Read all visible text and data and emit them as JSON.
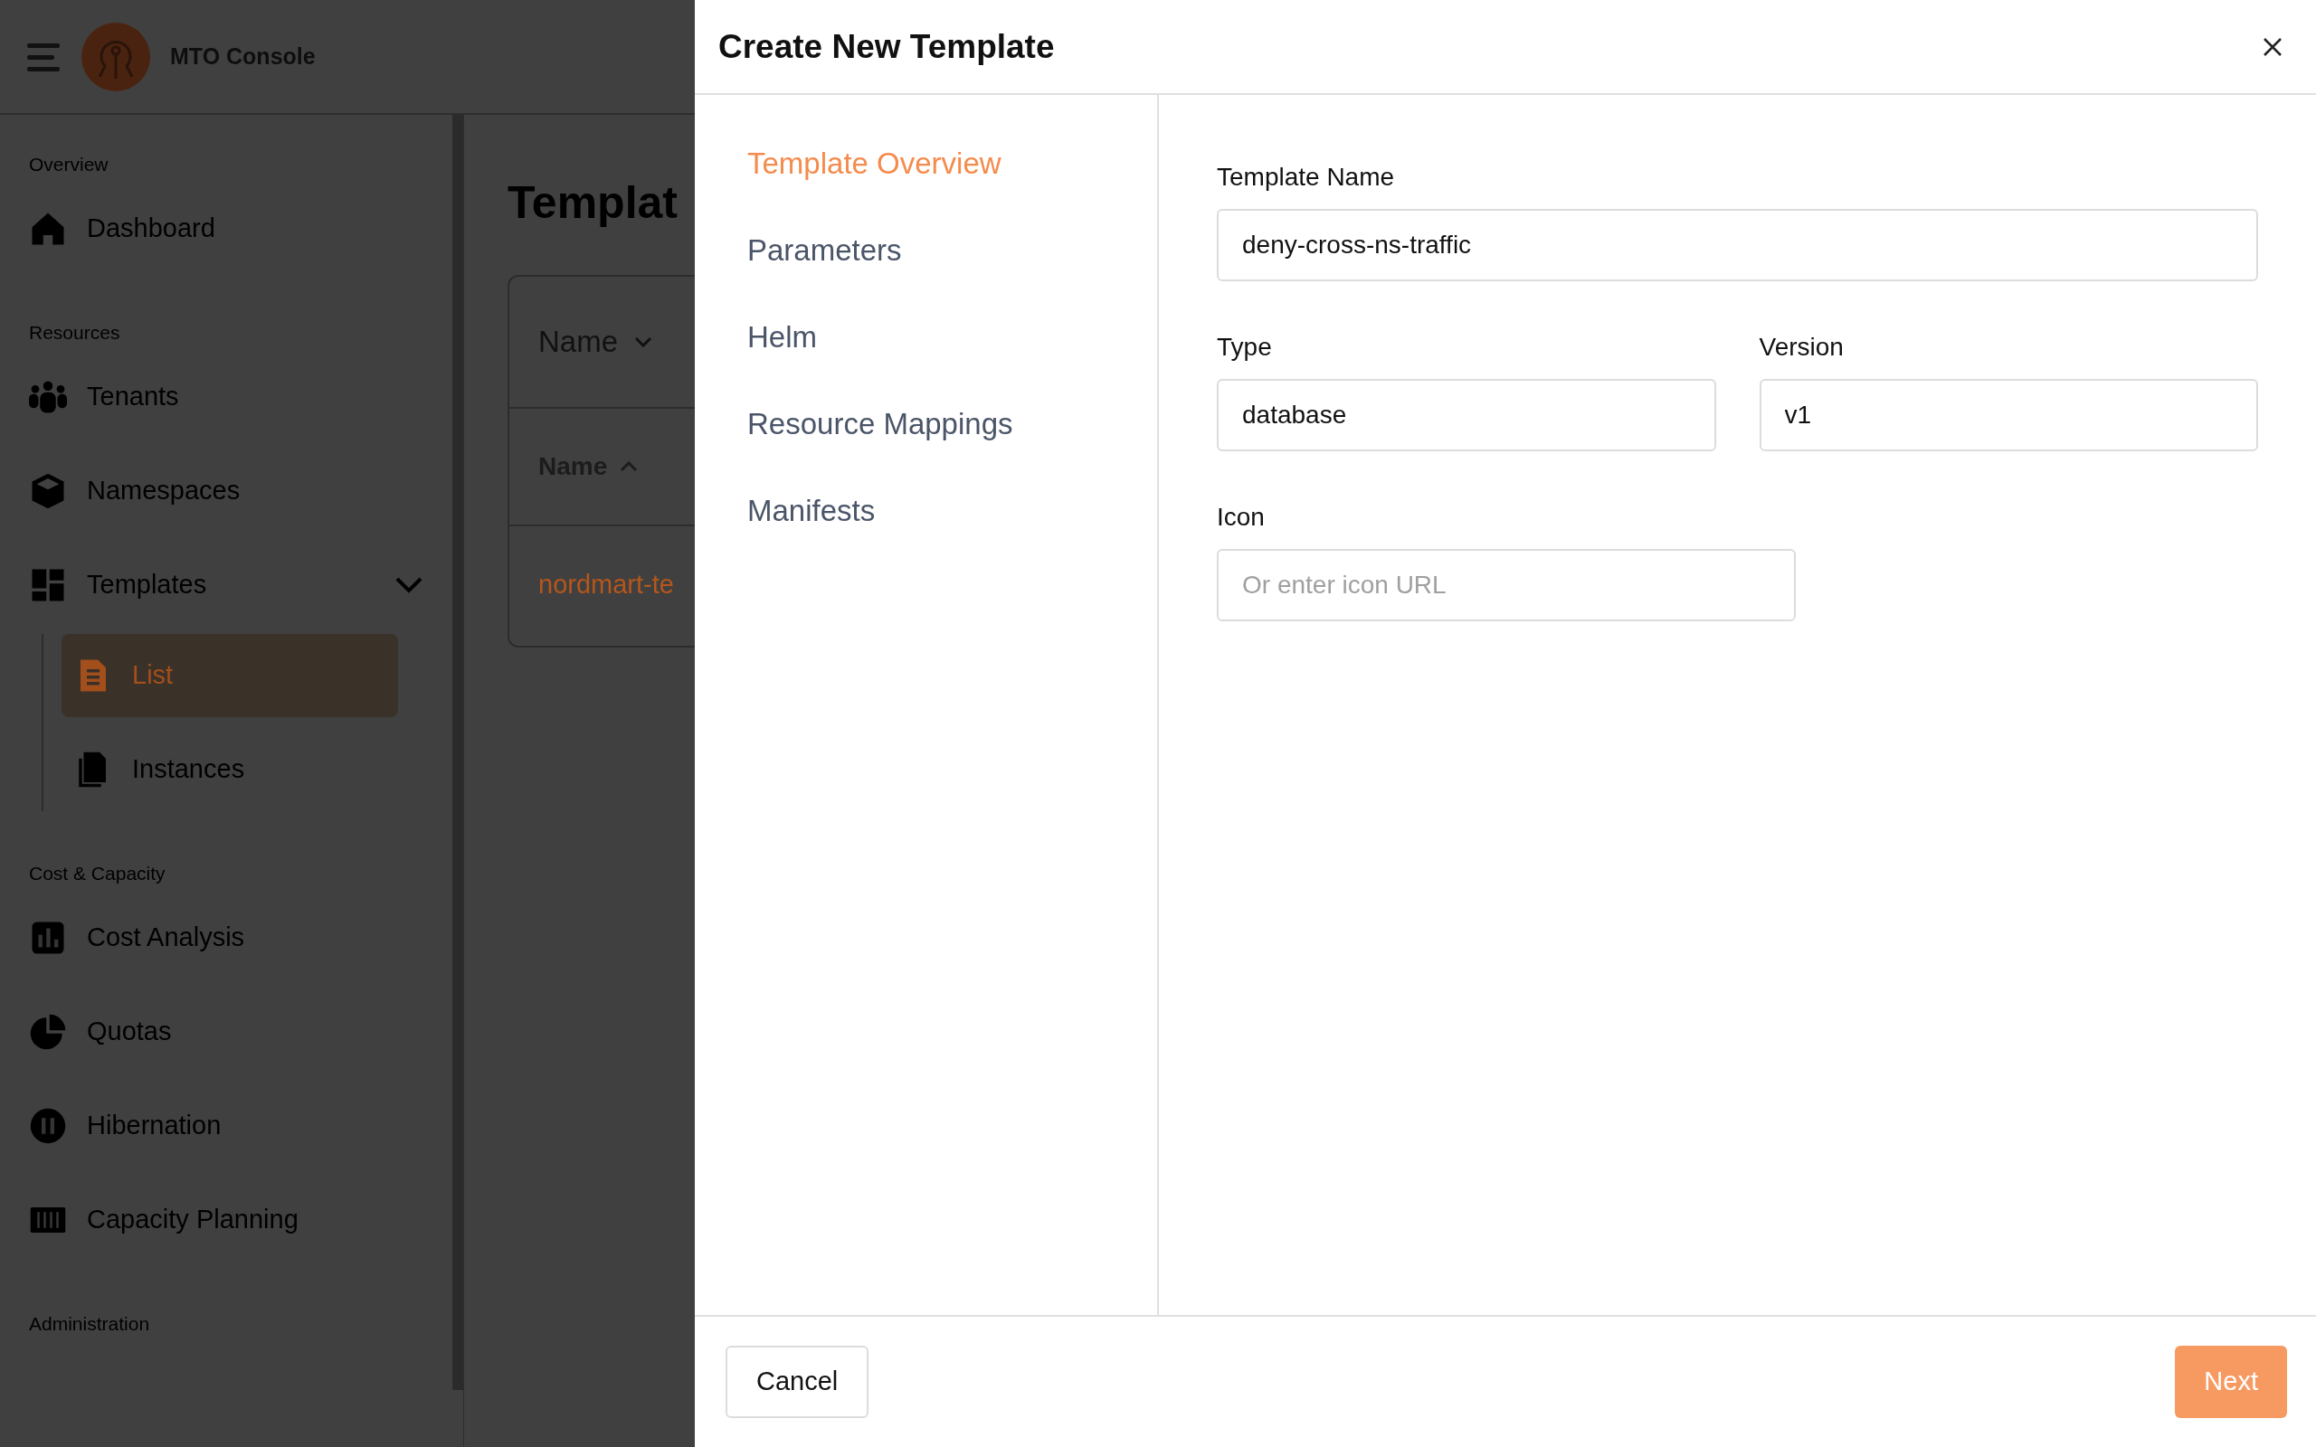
{
  "app": {
    "title": "MTO Console"
  },
  "sidebar": {
    "sections": [
      {
        "label": "Overview",
        "items": [
          {
            "label": "Dashboard",
            "selected": false
          }
        ]
      },
      {
        "label": "Resources",
        "items": [
          {
            "label": "Tenants",
            "selected": false
          },
          {
            "label": "Namespaces",
            "selected": false
          },
          {
            "label": "Templates",
            "selected": false,
            "expanded": true,
            "children": [
              {
                "label": "List",
                "selected": true
              },
              {
                "label": "Instances",
                "selected": false
              }
            ]
          }
        ]
      },
      {
        "label": "Cost & Capacity",
        "items": [
          {
            "label": "Cost Analysis",
            "selected": false
          },
          {
            "label": "Quotas",
            "selected": false
          },
          {
            "label": "Hibernation",
            "selected": false
          },
          {
            "label": "Capacity Planning",
            "selected": false
          }
        ]
      },
      {
        "label": "Administration"
      }
    ]
  },
  "main": {
    "title": "Templat",
    "filter": "Name",
    "table": {
      "column": "Name",
      "rows": [
        "nordmart-te"
      ]
    }
  },
  "dialog": {
    "title": "Create New Template",
    "steps": [
      {
        "label": "Template Overview",
        "selected": true
      },
      {
        "label": "Parameters",
        "selected": false
      },
      {
        "label": "Helm",
        "selected": false
      },
      {
        "label": "Resource Mappings",
        "selected": false
      },
      {
        "label": "Manifests",
        "selected": false
      }
    ],
    "fields": [
      {
        "label": "Template Name",
        "value": "deny-cross-ns-traffic"
      },
      {
        "label": "Type",
        "value": "database"
      },
      {
        "label": "Version",
        "value": "v1"
      },
      {
        "label": "Icon",
        "placeholder": "Or enter icon URL"
      }
    ],
    "buttons": {
      "cancel": "Cancel",
      "next": "Next"
    }
  }
}
